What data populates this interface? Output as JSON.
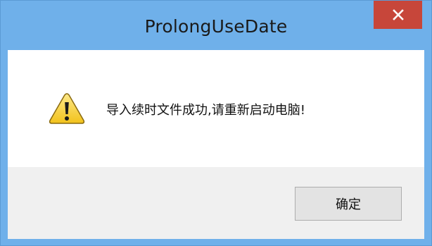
{
  "window": {
    "title": "ProlongUseDate"
  },
  "dialog": {
    "message": "导入续时文件成功,请重新启动电脑!",
    "icon": "warning-icon",
    "ok_label": "确定"
  },
  "colors": {
    "titlebar": "#6fb0ea",
    "close_button": "#c7463a",
    "button_area": "#f0f0f0",
    "warning_yellow": "#f7d13a"
  }
}
